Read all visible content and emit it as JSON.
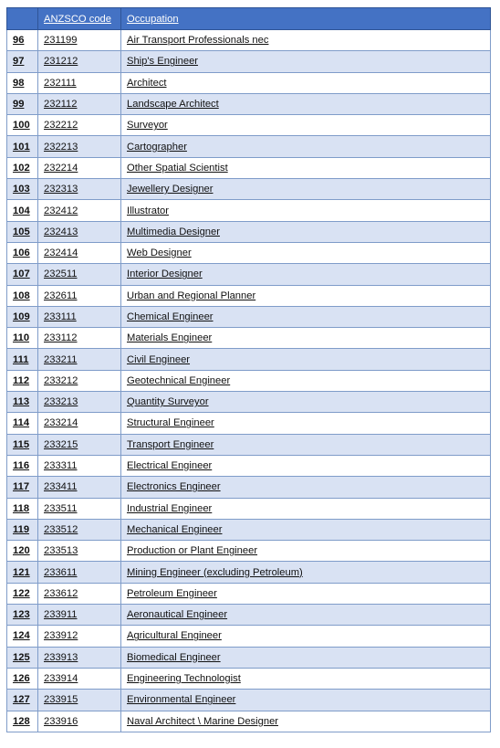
{
  "table": {
    "headers": [
      "",
      "ANZSCO code",
      "Occupation"
    ],
    "rows": [
      {
        "num": "96",
        "code": "231199",
        "occupation": "Air Transport Professionals nec"
      },
      {
        "num": "97",
        "code": "231212",
        "occupation": "Ship's Engineer"
      },
      {
        "num": "98",
        "code": "232111",
        "occupation": "Architect"
      },
      {
        "num": "99",
        "code": "232112",
        "occupation": "Landscape Architect"
      },
      {
        "num": "100",
        "code": "232212",
        "occupation": "Surveyor"
      },
      {
        "num": "101",
        "code": "232213",
        "occupation": "Cartographer"
      },
      {
        "num": "102",
        "code": "232214",
        "occupation": "Other Spatial Scientist"
      },
      {
        "num": "103",
        "code": "232313",
        "occupation": "Jewellery Designer"
      },
      {
        "num": "104",
        "code": "232412",
        "occupation": "Illustrator"
      },
      {
        "num": "105",
        "code": "232413",
        "occupation": "Multimedia Designer"
      },
      {
        "num": "106",
        "code": "232414",
        "occupation": "Web Designer"
      },
      {
        "num": "107",
        "code": "232511",
        "occupation": "Interior Designer"
      },
      {
        "num": "108",
        "code": "232611",
        "occupation": "Urban and Regional Planner"
      },
      {
        "num": "109",
        "code": "233111",
        "occupation": "Chemical Engineer"
      },
      {
        "num": "110",
        "code": "233112",
        "occupation": "Materials Engineer"
      },
      {
        "num": "111",
        "code": "233211",
        "occupation": "Civil Engineer"
      },
      {
        "num": "112",
        "code": "233212",
        "occupation": "Geotechnical Engineer"
      },
      {
        "num": "113",
        "code": "233213",
        "occupation": "Quantity Surveyor"
      },
      {
        "num": "114",
        "code": "233214",
        "occupation": "Structural Engineer"
      },
      {
        "num": "115",
        "code": "233215",
        "occupation": "Transport Engineer"
      },
      {
        "num": "116",
        "code": "233311",
        "occupation": "Electrical Engineer"
      },
      {
        "num": "117",
        "code": "233411",
        "occupation": "Electronics Engineer"
      },
      {
        "num": "118",
        "code": "233511",
        "occupation": "Industrial Engineer"
      },
      {
        "num": "119",
        "code": "233512",
        "occupation": "Mechanical Engineer"
      },
      {
        "num": "120",
        "code": "233513",
        "occupation": "Production or Plant Engineer"
      },
      {
        "num": "121",
        "code": "233611",
        "occupation": "Mining Engineer (excluding Petroleum)"
      },
      {
        "num": "122",
        "code": "233612",
        "occupation": "Petroleum Engineer"
      },
      {
        "num": "123",
        "code": "233911",
        "occupation": "Aeronautical Engineer"
      },
      {
        "num": "124",
        "code": "233912",
        "occupation": "Agricultural Engineer"
      },
      {
        "num": "125",
        "code": "233913",
        "occupation": "Biomedical Engineer"
      },
      {
        "num": "126",
        "code": "233914",
        "occupation": "Engineering Technologist"
      },
      {
        "num": "127",
        "code": "233915",
        "occupation": "Environmental Engineer"
      },
      {
        "num": "128",
        "code": "233916",
        "occupation": "Naval Architect \\ Marine Designer"
      }
    ]
  },
  "colors": {
    "header": "#4472C4",
    "alt_row": "#D9E2F3",
    "border": "#8EAADB"
  }
}
